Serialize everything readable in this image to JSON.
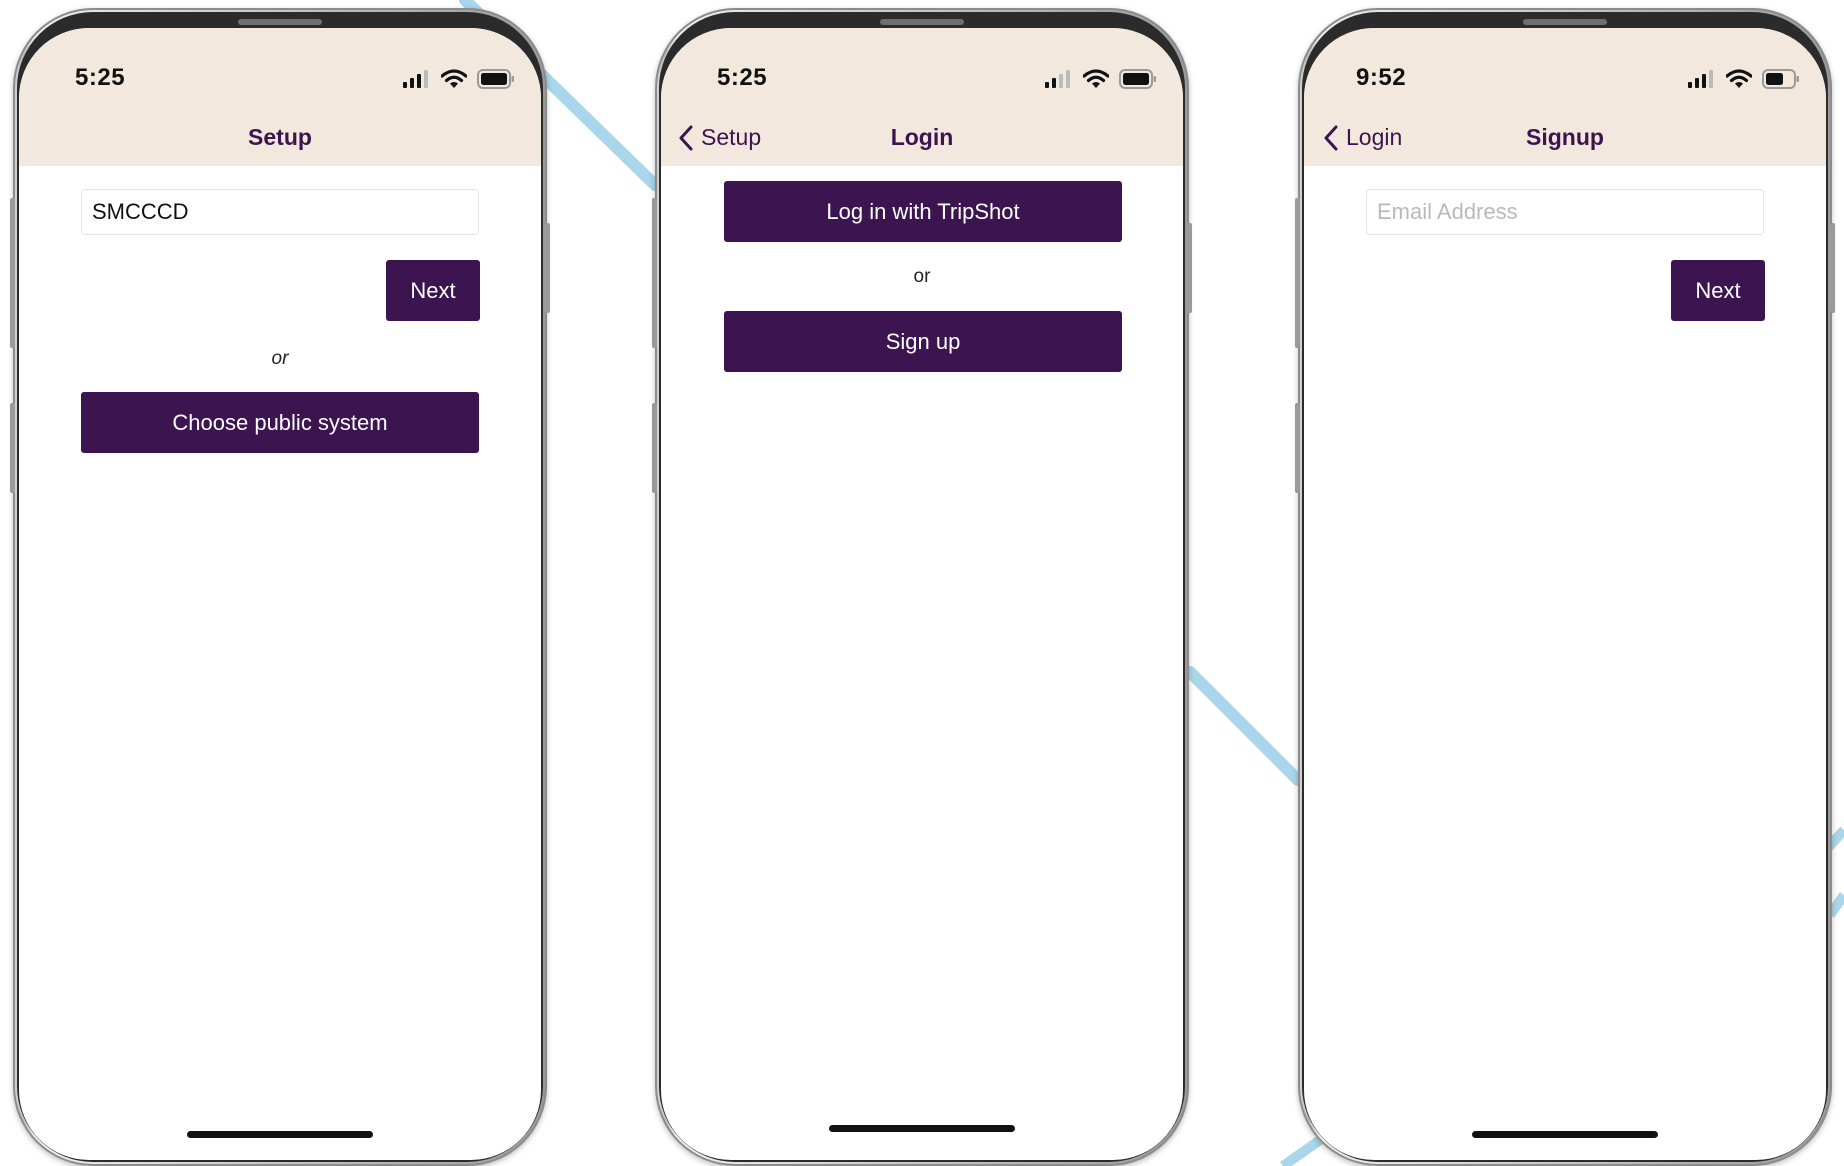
{
  "phones": [
    {
      "status_time": "5:25",
      "nav_title": "Setup",
      "code_input_value": "SMCCCD",
      "next_label": "Next",
      "or_label": "or",
      "choose_public_label": "Choose public system"
    },
    {
      "status_time": "5:25",
      "nav_back_label": "Setup",
      "nav_title": "Login",
      "login_tripshot_label": "Log in with TripShot",
      "or_label": "or",
      "signup_label": "Sign up"
    },
    {
      "status_time": "9:52",
      "nav_back_label": "Login",
      "nav_title": "Signup",
      "email_placeholder": "Email Address",
      "next_label": "Next"
    }
  ],
  "colors": {
    "header_bg": "#f3e8dd",
    "brand_purple": "#3c1450",
    "background": "#ffffff",
    "decor_line": "#a9d6ea"
  },
  "icons": {
    "signal": "cellular-signal-icon",
    "wifi": "wifi-icon",
    "battery": "battery-icon",
    "back": "chevron-left-icon"
  }
}
